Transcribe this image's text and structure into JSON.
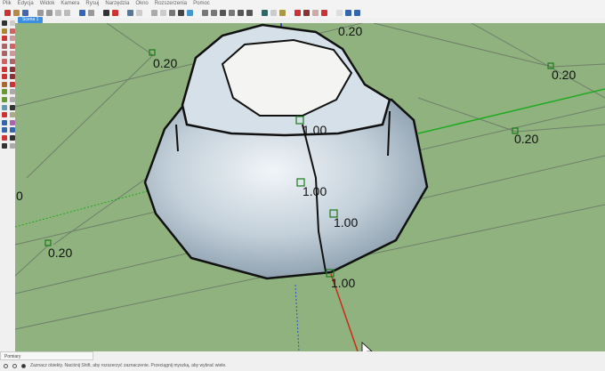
{
  "menu": [
    "Plik",
    "Edycja",
    "Widok",
    "Kamera",
    "Rysuj",
    "Narzędzia",
    "Okno",
    "Rozszerzenia",
    "Pomoc"
  ],
  "scene_tab": "Scena 1",
  "measurements_label": "Pomiary",
  "status_text": "Zaznacz obiekty. Naciśnij Shift, aby rozszerzyć zaznaczenie. Przeciągnij myszką, aby wybrać wiele.",
  "viewport": {
    "background": "#8fb27f",
    "labels": [
      "0.20",
      "0.20",
      "0.20",
      "0.20",
      "0.20",
      "1.00",
      "1.00",
      "1.00",
      "1.00",
      "0"
    ]
  }
}
